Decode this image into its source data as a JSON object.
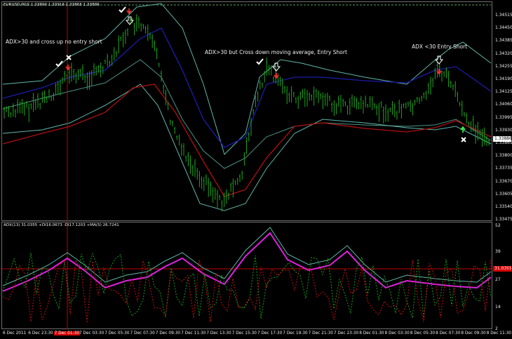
{
  "main_header": "EURUSD,M15  1.33890 1.33916 1.33865 1.33886",
  "adx_header": "ADX(13) 31.0355 +DI16.0673 -DI17.1203 +MA(5) 26.7241",
  "notes": {
    "left": "ADX>30 and cross up no entry short",
    "middle": "ADX>30 but Cross down moving average, Entry Short",
    "right": "ADX <30 Entry Short"
  },
  "price_axis": [
    "1.34515",
    "1.34450",
    "1.34385",
    "1.34320",
    "1.34255",
    "1.34190",
    "1.34125",
    "1.34060",
    "1.33995",
    "1.33930",
    "1.33865",
    "1.33800",
    "1.33735",
    "1.33670",
    "1.33605",
    "1.33540",
    "1.33475"
  ],
  "current_price": "1.33886",
  "adx_axis": [
    "52",
    "39",
    "27",
    "14",
    "2"
  ],
  "adx_level": "31.0355",
  "time_axis": [
    "6 Dec 2011",
    "6 Dec 23:30",
    "7 Dec 01:30",
    "7 Dec 03:30",
    "7 Dec 05:30",
    "7 Dec 07:30",
    "7 Dec 09:30",
    "7 Dec 11:30",
    "7 Dec 13:30",
    "7 Dec 15:30",
    "7 Dec 17:30",
    "7 Dec 19:30",
    "7 Dec 21:30",
    "7 Dec 23:30",
    "8 Dec 01:30",
    "8 Dec 03:30",
    "8 Dec 05:30",
    "8 Dec 07:30",
    "8 Dec 09:30",
    "8 Dec 11:30"
  ],
  "highlight_time": "7 Dec 01:30",
  "colors": {
    "candles": "#1ea51e",
    "upper_ma": "#1c1ca8",
    "lower_ma": "#b01010",
    "bands": "#5fb6a8",
    "adx_ma": "#e020e0",
    "plus_di": "#14a014",
    "minus_di": "#c81010",
    "crosshair": "#c00000"
  },
  "icons": [
    "check-icon",
    "cross-icon",
    "down-arrow-icon",
    "hollow-arrow-icon",
    "up-arrow-icon"
  ]
}
